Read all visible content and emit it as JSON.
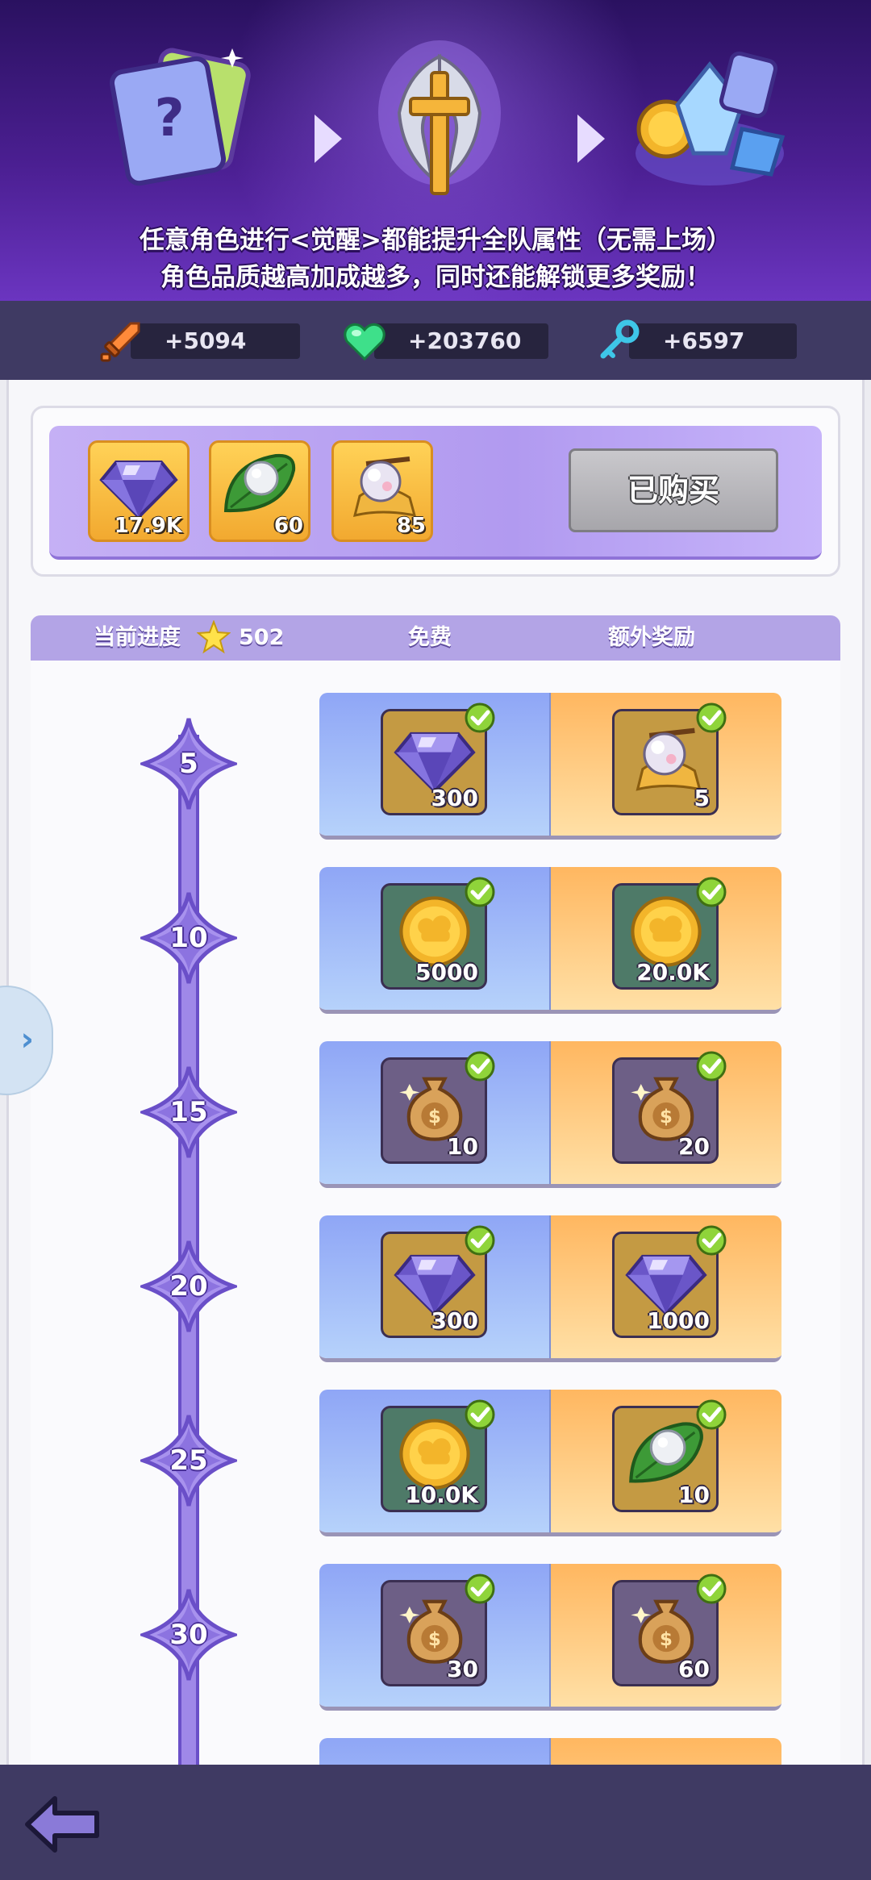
{
  "banner": {
    "line1": "任意角色进行<觉醒>都能提升全队属性（无需上场）",
    "line2": "角色品质越高加成越多，同时还能解锁更多奖励！"
  },
  "stats": {
    "attack": "+5094",
    "hp": "+203760",
    "key": "+6597"
  },
  "pack": {
    "items": [
      {
        "icon": "diamond-icon",
        "qty": "17.9K"
      },
      {
        "icon": "pearl-leaf-icon",
        "qty": "60"
      },
      {
        "icon": "crystal-ball-icon",
        "qty": "85"
      }
    ],
    "button_label": "已购买"
  },
  "header": {
    "progress_label": "当前进度",
    "progress_value": "502",
    "free_label": "免费",
    "extra_label": "额外奖励"
  },
  "rows": [
    {
      "level": "5",
      "free": {
        "icon": "diamond-icon",
        "qty": "300"
      },
      "extra": {
        "icon": "crystal-ball-icon",
        "qty": "5"
      }
    },
    {
      "level": "10",
      "free": {
        "icon": "gold-coin-icon",
        "qty": "5000"
      },
      "extra": {
        "icon": "gold-coin-icon",
        "qty": "20.0K"
      }
    },
    {
      "level": "15",
      "free": {
        "icon": "money-bag-icon",
        "qty": "10"
      },
      "extra": {
        "icon": "money-bag-icon",
        "qty": "20"
      }
    },
    {
      "level": "20",
      "free": {
        "icon": "diamond-icon",
        "qty": "300"
      },
      "extra": {
        "icon": "diamond-icon",
        "qty": "1000"
      }
    },
    {
      "level": "25",
      "free": {
        "icon": "gold-coin-icon",
        "qty": "10.0K"
      },
      "extra": {
        "icon": "pearl-leaf-icon",
        "qty": "10"
      }
    },
    {
      "level": "30",
      "free": {
        "icon": "money-bag-icon",
        "qty": "30"
      },
      "extra": {
        "icon": "money-bag-icon",
        "qty": "60"
      }
    }
  ],
  "colors": {
    "banner": "#4b1f92",
    "stats_bar": "#3f3a63",
    "free_column": "#9fb6f8",
    "extra_column": "#ffcb80",
    "claimed_check": "#8fd43a"
  },
  "side_tab_icon": "chevron-right-icon",
  "back_icon": "back-arrow-icon"
}
